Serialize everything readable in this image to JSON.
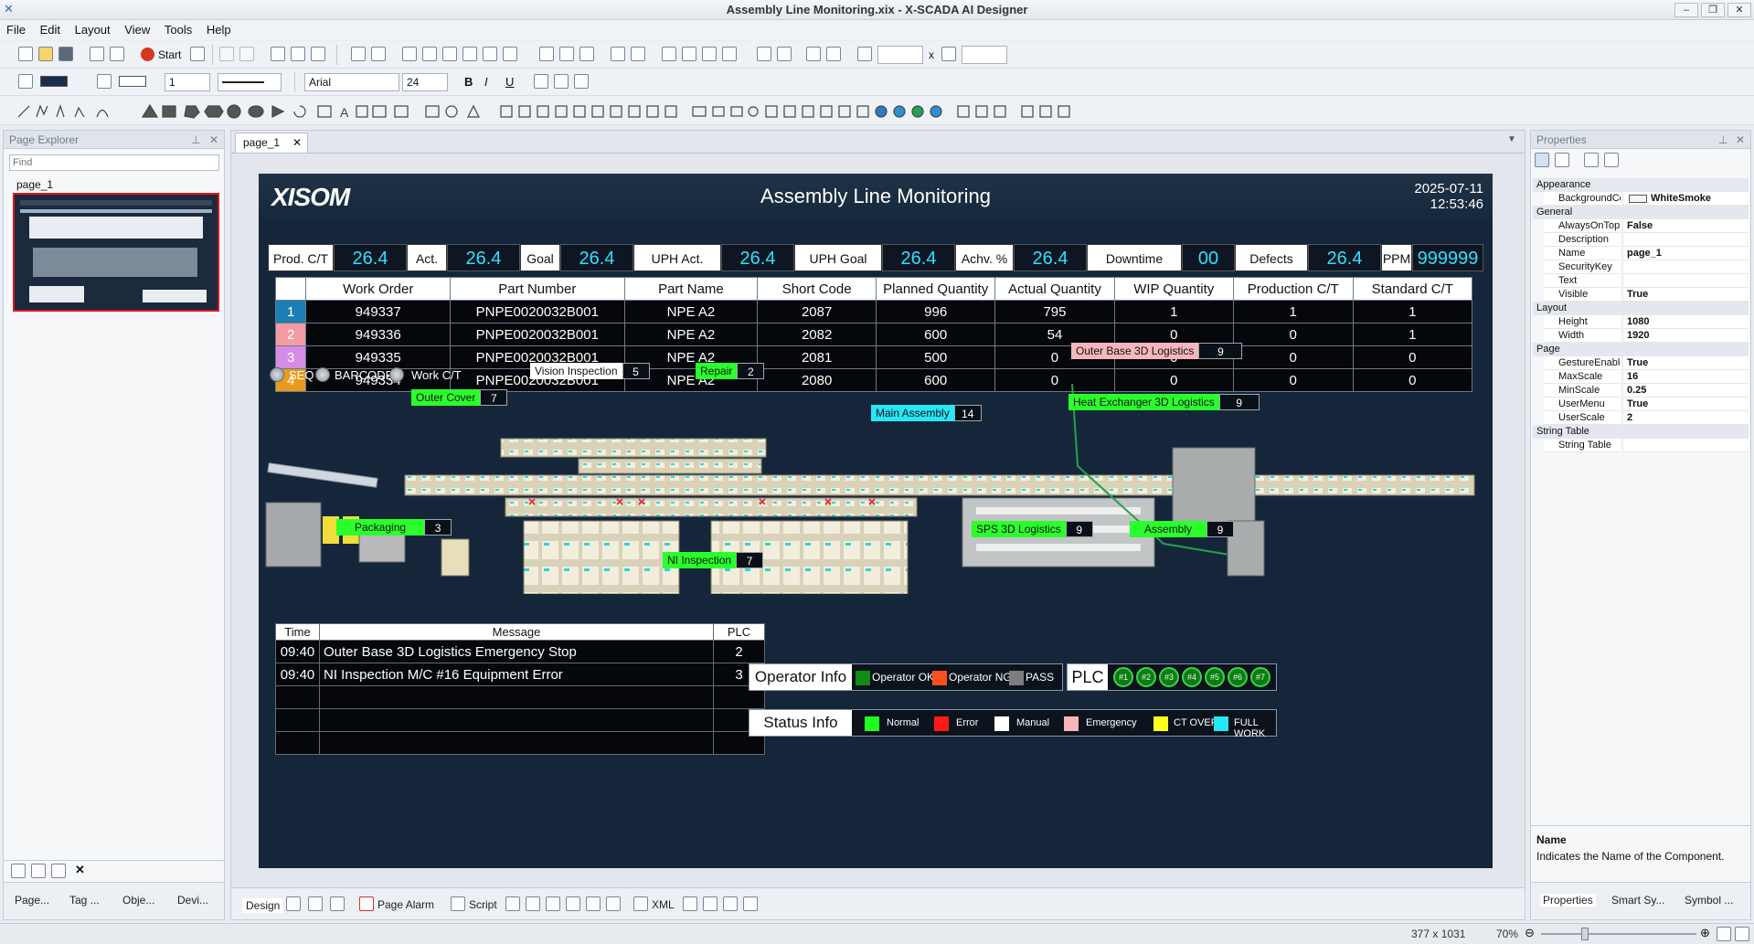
{
  "window": {
    "title": "Assembly Line Monitoring.xix - X-SCADA AI Designer"
  },
  "menu": [
    "File",
    "Edit",
    "Layout",
    "View",
    "Tools",
    "Help"
  ],
  "toolbar": {
    "start_label": "Start",
    "font": "Arial",
    "font_size": "24",
    "line_width": "1",
    "coord_sep": "x"
  },
  "page_explorer": {
    "title": "Page Explorer",
    "find_placeholder": "Find",
    "page": "page_1",
    "bottom_tabs": [
      "Page...",
      "Tag ...",
      "Obje...",
      "Devi..."
    ]
  },
  "editor": {
    "tab": "page_1",
    "bottom_tabs": [
      "Design",
      "Page Alarm",
      "Script",
      "XML"
    ]
  },
  "hmi": {
    "logo": "XISOM",
    "title": "Assembly Line Monitoring",
    "date": "2025-07-11",
    "time": "12:53:46",
    "kpis": [
      {
        "label": "Prod. C/T",
        "value": "26.4"
      },
      {
        "label": "Act.",
        "value": "26.4"
      },
      {
        "label": "Goal",
        "value": "26.4"
      },
      {
        "label": "UPH Act.",
        "value": "26.4"
      },
      {
        "label": "UPH Goal",
        "value": "26.4"
      },
      {
        "label": "Achv. %",
        "value": "26.4"
      },
      {
        "label": "Downtime",
        "value": "00"
      },
      {
        "label": "Defects",
        "value": "26.4"
      },
      {
        "label": "PPM",
        "value": "999999"
      }
    ],
    "wo_headers": [
      "Work Order",
      "Part Number",
      "Part Name",
      "Short Code",
      "Planned Quantity",
      "Actual Quantity",
      "WIP Quantity",
      "Production C/T",
      "Standard C/T"
    ],
    "wo_rows": [
      {
        "seq": "1",
        "color": "#1c7fb3",
        "cells": [
          "949337",
          "PNPE0020032B001",
          "NPE A2",
          "2087",
          "996",
          "795",
          "1",
          "1",
          "1"
        ]
      },
      {
        "seq": "2",
        "color": "#f39ca3",
        "cells": [
          "949336",
          "PNPE0020032B001",
          "NPE A2",
          "2082",
          "600",
          "54",
          "0",
          "0",
          "1"
        ]
      },
      {
        "seq": "3",
        "color": "#d48ce6",
        "cells": [
          "949335",
          "PNPE0020032B001",
          "NPE A2",
          "2081",
          "500",
          "0",
          "0",
          "0",
          "0"
        ]
      },
      {
        "seq": "4",
        "color": "#e99a1c",
        "cells": [
          "949334",
          "PNPE0020032B001",
          "NPE A2",
          "2080",
          "600",
          "0",
          "0",
          "0",
          "0"
        ]
      }
    ],
    "radios": [
      "SEQ",
      "BARCODE",
      "Work C/T"
    ],
    "stations": [
      {
        "label": "Vision Inspection",
        "count": "5",
        "color": "#ffffff"
      },
      {
        "label": "Repair",
        "count": "2",
        "color": "#2bff2b"
      },
      {
        "label": "Outer Cover",
        "count": "7",
        "color": "#2bff2b"
      },
      {
        "label": "Main Assembly",
        "count": "14",
        "color": "#27e6f5"
      },
      {
        "label": "Outer Base 3D Logistics",
        "count": "9",
        "color": "#f7b6bb"
      },
      {
        "label": "Heat Exchanger 3D Logistics",
        "count": "9",
        "color": "#2bff2b"
      },
      {
        "label": "Packaging",
        "count": "3",
        "color": "#2bff2b"
      },
      {
        "label": "SPS 3D Logistics",
        "count": "9",
        "color": "#2bff2b"
      },
      {
        "label": "Assembly",
        "count": "9",
        "color": "#2bff2b"
      },
      {
        "label": "NI Inspection",
        "count": "7",
        "color": "#2bff2b"
      }
    ],
    "alarm_headers": [
      "Time",
      "Message",
      "PLC"
    ],
    "alarms": [
      {
        "time": "09:40",
        "message": "Outer Base 3D Logistics Emergency Stop",
        "plc": "2"
      },
      {
        "time": "09:40",
        "message": "NI Inspection M/C #16 Equipment Error",
        "plc": "3"
      },
      {
        "time": "",
        "message": "",
        "plc": ""
      },
      {
        "time": "",
        "message": "",
        "plc": ""
      },
      {
        "time": "",
        "message": "",
        "plc": ""
      }
    ],
    "operator_info": {
      "title": "Operator Info",
      "items": [
        {
          "label": "Operator OK",
          "color": "#118a16"
        },
        {
          "label": "Operator NG",
          "color": "#ff4e1e"
        },
        {
          "label": "PASS",
          "color": "#7d7d7d"
        }
      ]
    },
    "plc": {
      "title": "PLC",
      "items": [
        "#1",
        "#2",
        "#3",
        "#4",
        "#5",
        "#6",
        "#7"
      ]
    },
    "status_info": {
      "title": "Status Info",
      "items": [
        {
          "label": "Normal",
          "color": "#1cff1c"
        },
        {
          "label": "Error",
          "color": "#ff1a1a"
        },
        {
          "label": "Manual",
          "color": "#ffffff"
        },
        {
          "label": "Emergency",
          "color": "#f7b6bb"
        },
        {
          "label": "CT OVER",
          "color": "#ffff1c"
        },
        {
          "label": "FULL WORK",
          "color": "#25e8f7"
        }
      ]
    }
  },
  "properties": {
    "title": "Properties",
    "groups": [
      {
        "name": "Appearance",
        "rows": [
          {
            "k": "BackgroundColor",
            "v": "WhiteSmoke"
          }
        ]
      },
      {
        "name": "General",
        "rows": [
          {
            "k": "AlwaysOnTop",
            "v": "False"
          },
          {
            "k": "Description",
            "v": ""
          },
          {
            "k": "Name",
            "v": "page_1"
          },
          {
            "k": "SecurityKey",
            "v": ""
          },
          {
            "k": "Text",
            "v": ""
          },
          {
            "k": "Visible",
            "v": "True"
          }
        ]
      },
      {
        "name": "Layout",
        "rows": [
          {
            "k": "Height",
            "v": "1080"
          },
          {
            "k": "Width",
            "v": "1920"
          }
        ]
      },
      {
        "name": "Page",
        "rows": [
          {
            "k": "GestureEnable",
            "v": "True"
          },
          {
            "k": "MaxScale",
            "v": "16"
          },
          {
            "k": "MinScale",
            "v": "0.25"
          },
          {
            "k": "UserMenu",
            "v": "True"
          },
          {
            "k": "UserScale",
            "v": "2"
          }
        ]
      },
      {
        "name": "String Table",
        "rows": [
          {
            "k": "String Table",
            "v": ""
          }
        ]
      }
    ],
    "desc_title": "Name",
    "desc_text": "Indicates the Name of the Component.",
    "bottom_tabs": [
      "Properties",
      "Smart Sy...",
      "Symbol ..."
    ]
  },
  "statusbar": {
    "size": "377 x 1031",
    "zoom": "70%"
  }
}
